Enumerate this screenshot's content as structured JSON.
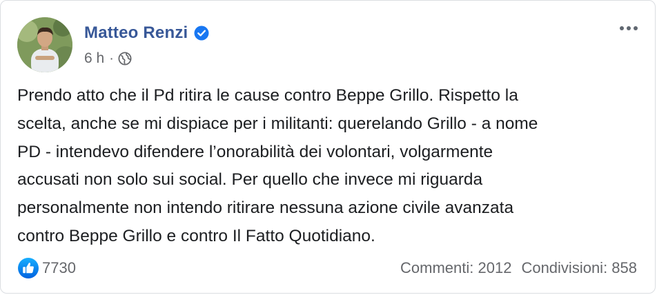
{
  "post": {
    "author": "Matteo Renzi",
    "timestamp": "6 h",
    "separator": "·",
    "audience_icon": "globe-icon",
    "verified_icon": "verified-badge-icon",
    "more_icon": "more-options-icon",
    "message_lines": [
      "Prendo atto che il Pd ritira le cause contro Beppe Grillo. Rispetto la",
      "scelta, anche se mi dispiace per i militanti: querelando Grillo - a nome",
      "PD - intendevo difendere l’onorabilità dei volontari, volgarmente",
      "accusati non solo sui social. Per quello che invece mi riguarda",
      "personalmente non intendo ritirare nessuna azione civile avanzata",
      "contro Beppe Grillo e contro Il Fatto Quotidiano."
    ],
    "reaction_icon": "like-reaction-icon",
    "reaction_count": "7730",
    "comments": "Commenti: 2012",
    "shares": "Condivisioni: 858"
  },
  "colors": {
    "author_link": "#385898",
    "verified_badge": "#1877f2",
    "secondary_text": "#65676b",
    "like_blue": "#1877f2",
    "border": "#dadde1"
  }
}
